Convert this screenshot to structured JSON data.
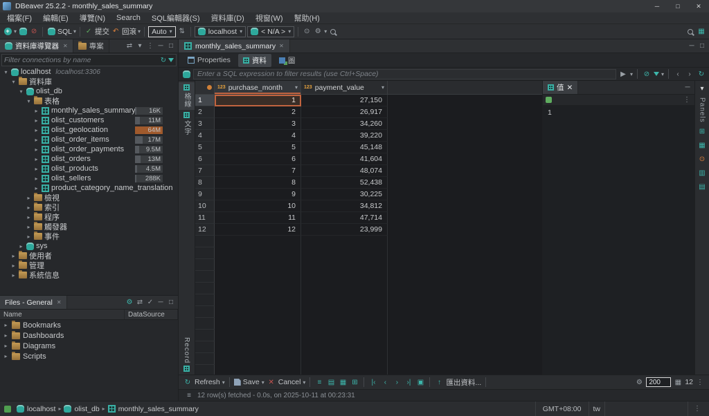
{
  "icons": {
    "close": "✕",
    "chevron_down": "▾",
    "chevron_right": "▸",
    "play": "▶",
    "back": "‹",
    "forward": "›",
    "first": "|‹",
    "last": "›|",
    "refresh": "↻",
    "rollback": "↶",
    "commit": "✓",
    "menu": "⋮",
    "minimize": "─",
    "maximize": "□",
    "panel_min": "▾",
    "gear": "⚙",
    "export_arrow": "↑",
    "swap": "⇄",
    "link": "⇄",
    "focus": "▣",
    "aggregate": "▦",
    "calc": "⊞",
    "refs": "▥",
    "pin": "⊙",
    "rows_filter": "≡",
    "grouping": "▤",
    "cancel": "✕",
    "disconnect": "⊘",
    "updown": "⇅",
    "grid": "▦"
  },
  "window": {
    "title": "DBeaver 25.2.2 - monthly_sales_summary"
  },
  "menu": {
    "items": [
      "檔案(F)",
      "編輯(E)",
      "導覽(N)",
      "Search",
      "SQL編輯器(S)",
      "資料庫(D)",
      "視窗(W)",
      "幫助(H)"
    ]
  },
  "toolbar": {
    "sql_label": "SQL",
    "commit_label": "提交",
    "rollback_label": "回滾",
    "auto_value": "Auto",
    "connection_value": "localhost",
    "database_value": "< N/A >"
  },
  "navigator": {
    "tab_db": "資料庫導覽器",
    "tab_projects": "專案",
    "filter_placeholder": "Filter connections by name",
    "tree": [
      {
        "level": 0,
        "expanded": true,
        "icon": "db",
        "label": "localhost",
        "suffix": "localhost:3306"
      },
      {
        "level": 1,
        "expanded": true,
        "icon": "folder",
        "label": "資料庫"
      },
      {
        "level": 2,
        "expanded": true,
        "icon": "db",
        "label": "olist_db"
      },
      {
        "level": 3,
        "expanded": true,
        "icon": "folder",
        "label": "表格"
      },
      {
        "level": 4,
        "expanded": false,
        "icon": "table",
        "label": "monthly_sales_summary",
        "badge": "16K",
        "bar": 0.06
      },
      {
        "level": 4,
        "expanded": false,
        "icon": "table",
        "label": "olist_customers",
        "badge": "11M",
        "bar": 0.17
      },
      {
        "level": 4,
        "expanded": false,
        "icon": "table",
        "label": "olist_geolocation",
        "badge": "64M",
        "bar": 1,
        "hot": true
      },
      {
        "level": 4,
        "expanded": false,
        "icon": "table",
        "label": "olist_order_items",
        "badge": "17M",
        "bar": 0.27
      },
      {
        "level": 4,
        "expanded": false,
        "icon": "table",
        "label": "olist_order_payments",
        "badge": "9.5M",
        "bar": 0.15
      },
      {
        "level": 4,
        "expanded": false,
        "icon": "table",
        "label": "olist_orders",
        "badge": "13M",
        "bar": 0.2
      },
      {
        "level": 4,
        "expanded": false,
        "icon": "table",
        "label": "olist_products",
        "badge": "4.5M",
        "bar": 0.08
      },
      {
        "level": 4,
        "expanded": false,
        "icon": "table",
        "label": "olist_sellers",
        "badge": "288K",
        "bar": 0.06
      },
      {
        "level": 4,
        "expanded": false,
        "icon": "table",
        "label": "product_category_name_translation"
      },
      {
        "level": 3,
        "expanded": false,
        "icon": "folder",
        "label": "檢視"
      },
      {
        "level": 3,
        "expanded": false,
        "icon": "folder",
        "label": "索引"
      },
      {
        "level": 3,
        "expanded": false,
        "icon": "folder",
        "label": "程序"
      },
      {
        "level": 3,
        "expanded": false,
        "icon": "folder",
        "label": "觸發器"
      },
      {
        "level": 3,
        "expanded": false,
        "icon": "folder",
        "label": "事件"
      },
      {
        "level": 2,
        "expanded": false,
        "icon": "db",
        "label": "sys"
      },
      {
        "level": 1,
        "expanded": false,
        "icon": "folder",
        "label": "使用者"
      },
      {
        "level": 1,
        "expanded": false,
        "icon": "folder",
        "label": "管理"
      },
      {
        "level": 1,
        "expanded": false,
        "icon": "folder",
        "label": "系統信息"
      }
    ]
  },
  "files_panel": {
    "tab": "Files - General",
    "columns": [
      "Name",
      "DataSource"
    ],
    "rows": [
      "Bookmarks",
      "Dashboards",
      "Diagrams",
      "Scripts"
    ]
  },
  "editor": {
    "tab": "monthly_sales_summary",
    "subtabs": [
      {
        "label": "Properties",
        "active": false,
        "icon": "props"
      },
      {
        "label": "資料",
        "active": true,
        "icon": "grid"
      },
      {
        "label": "圖",
        "active": false,
        "icon": "diagram"
      }
    ],
    "filter_placeholder": "Enter a SQL expression to filter results (use Ctrl+Space)",
    "left_tabs": [
      "格線",
      "文字"
    ],
    "record_label": "Record",
    "panels_label": "Panels"
  },
  "grid": {
    "columns": [
      {
        "type": "123",
        "name": "purchase_month"
      },
      {
        "type": "123",
        "name": "payment_value"
      }
    ],
    "rows": [
      {
        "num": "1",
        "purchase_month": "1",
        "payment_value": "27,150"
      },
      {
        "num": "2",
        "purchase_month": "2",
        "payment_value": "26,917"
      },
      {
        "num": "3",
        "purchase_month": "3",
        "payment_value": "34,260"
      },
      {
        "num": "4",
        "purchase_month": "4",
        "payment_value": "39,220"
      },
      {
        "num": "5",
        "purchase_month": "5",
        "payment_value": "45,148"
      },
      {
        "num": "6",
        "purchase_month": "6",
        "payment_value": "41,604"
      },
      {
        "num": "7",
        "purchase_month": "7",
        "payment_value": "48,074"
      },
      {
        "num": "8",
        "purchase_month": "8",
        "payment_value": "52,438"
      },
      {
        "num": "9",
        "purchase_month": "9",
        "payment_value": "30,225"
      },
      {
        "num": "10",
        "purchase_month": "10",
        "payment_value": "34,812"
      },
      {
        "num": "11",
        "purchase_month": "11",
        "payment_value": "47,714"
      },
      {
        "num": "12",
        "purchase_month": "12",
        "payment_value": "23,999"
      }
    ],
    "selected": {
      "row": 1,
      "column": "purchase_month"
    }
  },
  "value_panel": {
    "tab": "值",
    "content": "1"
  },
  "results_toolbar": {
    "refresh_label": "Refresh",
    "save_label": "Save",
    "cancel_label": "Cancel",
    "export_label": "匯出資料...",
    "fetch_size": "200",
    "row_count": "12"
  },
  "status_line": "12 row(s) fetched - 0.0s, on 2025-10-11 at 00:23:31",
  "statusbar": {
    "breadcrumbs": [
      {
        "label": "localhost",
        "icon": "db"
      },
      {
        "label": "olist_db",
        "icon": "db"
      },
      {
        "label": "monthly_sales_summary",
        "icon": "table"
      }
    ],
    "timezone": "GMT+08:00",
    "locale": "tw"
  }
}
